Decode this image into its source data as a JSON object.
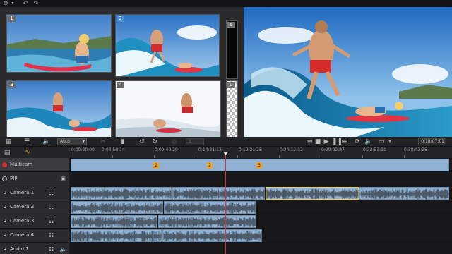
{
  "window": {
    "menu_icons": [
      "gear-icon",
      "undo-icon",
      "redo-icon"
    ]
  },
  "multicam_grid": {
    "cells": [
      {
        "number": "1",
        "active": false
      },
      {
        "number": "2",
        "active": true
      },
      {
        "number": "3",
        "active": false
      },
      {
        "number": "4",
        "active": false
      }
    ],
    "side_slots": [
      {
        "number": "5"
      },
      {
        "number": "0"
      }
    ]
  },
  "toolbar": {
    "layout_select_value": "Auto",
    "stepper_value": "1",
    "timecode": "0:18:07:01",
    "fps_value": "01"
  },
  "timeline": {
    "ruler_labels": [
      "0:00:00:00",
      "0:04:50:14",
      "0:09:40:29",
      "0:14:31:13",
      "0:19:21:28",
      "0:24:12:12",
      "0:29:02:27",
      "0:33:53:11",
      "0:38:43:26"
    ],
    "tracks": [
      {
        "label": "Multicam",
        "kind": "multicam"
      },
      {
        "label": "PIP",
        "kind": "pip"
      },
      {
        "label": "Camera 1",
        "kind": "camera"
      },
      {
        "label": "Camera 2",
        "kind": "camera"
      },
      {
        "label": "Camera 3",
        "kind": "camera"
      },
      {
        "label": "Camera 4",
        "kind": "camera"
      },
      {
        "label": "Audio 1",
        "kind": "audio"
      }
    ],
    "multicam_markers": [
      "2",
      "2",
      "3"
    ]
  },
  "colors": {
    "accent": "#4a90d9",
    "clip": "#8fb0d0",
    "selected_clip_border": "#f0d030",
    "playhead": "#e03030",
    "record": "#d92b2b"
  }
}
